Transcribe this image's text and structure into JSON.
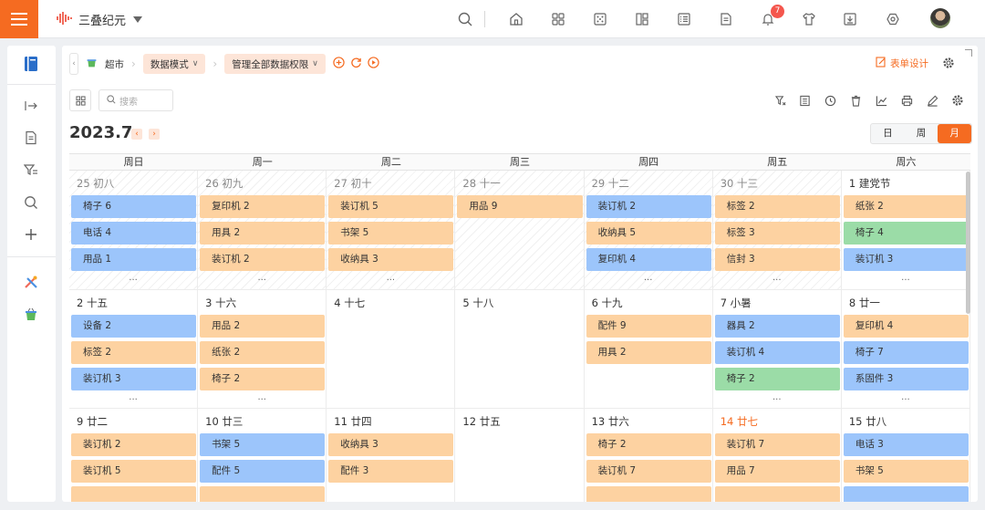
{
  "app": {
    "name": "三叠纪元",
    "notifications": "7",
    "accent": "#f56b21"
  },
  "breadcrumb": {
    "root": "超市",
    "view_mode": "数据模式",
    "permission": "管理全部数据权限"
  },
  "toolbar": {
    "form_design": "表单设计",
    "search_placeholder": "搜索"
  },
  "calendar": {
    "title": "2023.7",
    "views": {
      "day": "日",
      "week": "周",
      "month": "月",
      "active": "month"
    },
    "weekdays": [
      "周日",
      "周一",
      "周二",
      "周三",
      "周四",
      "周五",
      "周六"
    ],
    "more": "···",
    "weeks": [
      [
        {
          "date": "25 初八",
          "other": true,
          "events": [
            {
              "t": "椅子  6",
              "c": "blue"
            },
            {
              "t": "电话  4",
              "c": "blue"
            },
            {
              "t": "用品  1",
              "c": "blue"
            }
          ],
          "more": true
        },
        {
          "date": "26 初九",
          "other": true,
          "events": [
            {
              "t": "复印机  2",
              "c": "orange"
            },
            {
              "t": "用具  2",
              "c": "orange"
            },
            {
              "t": "装订机  2",
              "c": "orange"
            }
          ],
          "more": true
        },
        {
          "date": "27 初十",
          "other": true,
          "events": [
            {
              "t": "装订机  5",
              "c": "orange"
            },
            {
              "t": "书架  5",
              "c": "orange"
            },
            {
              "t": "收纳具  3",
              "c": "orange"
            }
          ],
          "more": true
        },
        {
          "date": "28 十一",
          "other": true,
          "events": [
            {
              "t": "用品  9",
              "c": "orange"
            }
          ],
          "more": false
        },
        {
          "date": "29 十二",
          "other": true,
          "events": [
            {
              "t": "装订机  2",
              "c": "blue"
            },
            {
              "t": "收纳具  5",
              "c": "orange"
            },
            {
              "t": "复印机  4",
              "c": "blue"
            }
          ],
          "more": true
        },
        {
          "date": "30 十三",
          "other": true,
          "events": [
            {
              "t": "标签  2",
              "c": "orange"
            },
            {
              "t": "标签  3",
              "c": "orange"
            },
            {
              "t": "信封  3",
              "c": "orange"
            }
          ],
          "more": true
        },
        {
          "date": "1 建党节",
          "other": false,
          "events": [
            {
              "t": "纸张  2",
              "c": "orange"
            },
            {
              "t": "椅子  4",
              "c": "green"
            },
            {
              "t": "装订机  3",
              "c": "blue"
            }
          ],
          "more": true
        }
      ],
      [
        {
          "date": "2 十五",
          "events": [
            {
              "t": "设备  2",
              "c": "blue"
            },
            {
              "t": "标签  2",
              "c": "orange"
            },
            {
              "t": "装订机  3",
              "c": "blue"
            }
          ],
          "more": true
        },
        {
          "date": "3 十六",
          "events": [
            {
              "t": "用品  2",
              "c": "orange"
            },
            {
              "t": "纸张  2",
              "c": "orange"
            },
            {
              "t": "椅子  2",
              "c": "orange"
            }
          ],
          "more": true
        },
        {
          "date": "4 十七",
          "events": [],
          "more": false
        },
        {
          "date": "5 十八",
          "events": [],
          "more": false
        },
        {
          "date": "6 十九",
          "events": [
            {
              "t": "配件  9",
              "c": "orange"
            },
            {
              "t": "用具  2",
              "c": "orange"
            }
          ],
          "more": false
        },
        {
          "date": "7 小暑",
          "events": [
            {
              "t": "器具  2",
              "c": "blue"
            },
            {
              "t": "装订机  4",
              "c": "blue"
            },
            {
              "t": "椅子  2",
              "c": "green"
            }
          ],
          "more": true
        },
        {
          "date": "8 廿一",
          "events": [
            {
              "t": "复印机  4",
              "c": "orange"
            },
            {
              "t": "椅子  7",
              "c": "blue"
            },
            {
              "t": "系固件  3",
              "c": "blue"
            }
          ],
          "more": true
        }
      ],
      [
        {
          "date": "9 廿二",
          "events": [
            {
              "t": "装订机  2",
              "c": "orange"
            },
            {
              "t": "装订机  5",
              "c": "orange"
            },
            {
              "t": "",
              "c": "orange"
            }
          ],
          "more": false
        },
        {
          "date": "10 廿三",
          "events": [
            {
              "t": "书架  5",
              "c": "blue"
            },
            {
              "t": "配件  5",
              "c": "blue"
            },
            {
              "t": "",
              "c": "orange"
            }
          ],
          "more": false
        },
        {
          "date": "11 廿四",
          "events": [
            {
              "t": "收纳具  3",
              "c": "orange"
            },
            {
              "t": "配件  3",
              "c": "orange"
            }
          ],
          "more": false
        },
        {
          "date": "12 廿五",
          "events": [],
          "more": false
        },
        {
          "date": "13 廿六",
          "events": [
            {
              "t": "椅子  2",
              "c": "orange"
            },
            {
              "t": "装订机  7",
              "c": "orange"
            },
            {
              "t": "",
              "c": "orange"
            }
          ],
          "more": false
        },
        {
          "date": "14 廿七",
          "highlight": true,
          "events": [
            {
              "t": "装订机  7",
              "c": "orange"
            },
            {
              "t": "用品  7",
              "c": "orange"
            },
            {
              "t": "",
              "c": "orange"
            }
          ],
          "more": false
        },
        {
          "date": "15 廿八",
          "events": [
            {
              "t": "电话  3",
              "c": "blue"
            },
            {
              "t": "书架  5",
              "c": "orange"
            },
            {
              "t": "",
              "c": "blue"
            }
          ],
          "more": false
        }
      ]
    ]
  }
}
